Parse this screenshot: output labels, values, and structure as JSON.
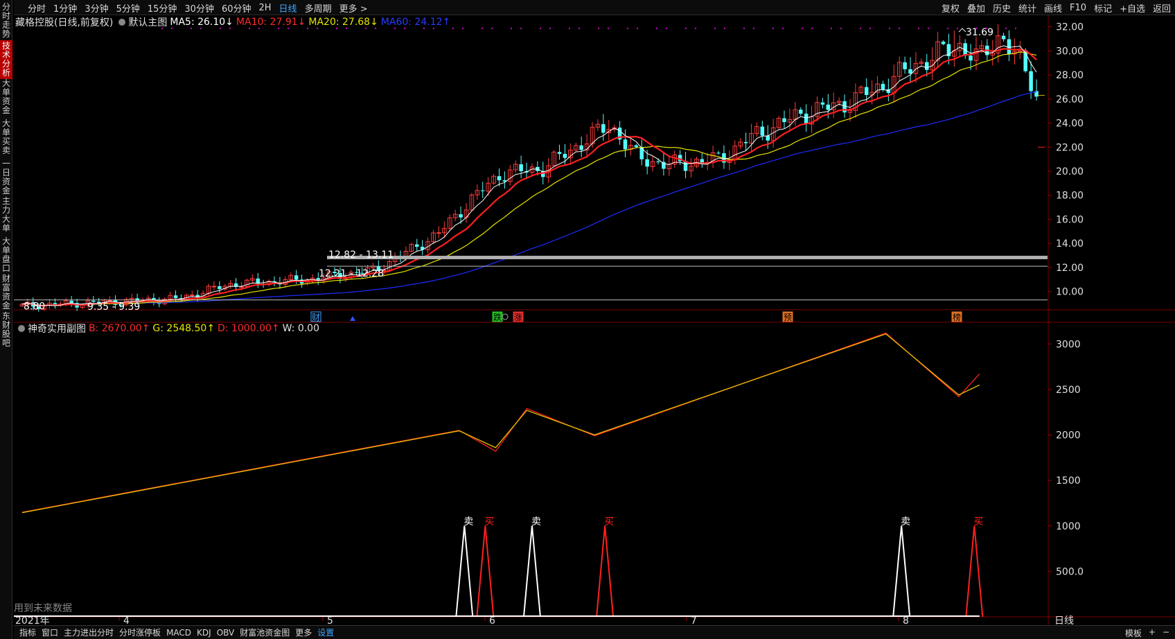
{
  "toolbar": {
    "periods": [
      "分时",
      "1分钟",
      "3分钟",
      "5分钟",
      "15分钟",
      "30分钟",
      "60分钟",
      "2H",
      "日线",
      "多周期",
      "更多 >"
    ],
    "active_period": "日线",
    "right": [
      "复权",
      "叠加",
      "历史",
      "统计",
      "画线",
      "F10",
      "标记",
      "+自选",
      "返回"
    ]
  },
  "sidebar": [
    "分时走势",
    "技术分析",
    "大单资金",
    "大单买卖",
    "一日资金",
    "主力大单",
    "大单盘口",
    "财富资金",
    "东财股吧"
  ],
  "sidebar_active": "技术分析",
  "main_legend": {
    "stock": "藏格控股(日线,前复权)",
    "template": "默认主图",
    "ma5": "MA5: 26.10↓",
    "ma10": "MA10: 27.91↓",
    "ma20": "MA20: 27.68↓",
    "ma60": "MA60: 24.12↑"
  },
  "sub_legend": {
    "name": "神奇实用副图",
    "b": "B: 2670.00↑",
    "g": "G: 2548.50↑",
    "d": "D: 1000.00↑",
    "w": "W: 0.00"
  },
  "annotations": {
    "high": "31.69",
    "low": "8.80",
    "range1": "9.35 - 9.39",
    "range2": "12.21 - 12.28",
    "range3": "12.82 - 13.11",
    "future_data": "用到未来数据"
  },
  "event_markers": [
    "财",
    "跌",
    "涨",
    "预",
    "榜"
  ],
  "signals": {
    "sell": "卖",
    "buy": "买"
  },
  "x_axis": {
    "year": "2021年",
    "months": [
      "4",
      "5",
      "6",
      "7",
      "8"
    ],
    "period_label": "日线"
  },
  "colors": {
    "up": "#ff3b3b",
    "down": "#54ffff",
    "ma5": "#ffffff",
    "ma10": "#ff2020",
    "ma20": "#e6e600",
    "ma60": "#1e2cff"
  },
  "chart_data": [
    {
      "type": "candlestick",
      "ylim": [
        9.0,
        32.5
      ],
      "yticks": [
        "32.00",
        "30.00",
        "28.00",
        "26.00",
        "24.00",
        "22.00",
        "20.00",
        "18.00",
        "16.00",
        "14.00",
        "12.00",
        "10.00"
      ],
      "first_close": 8.8,
      "last_close": 26.2,
      "max_high": 31.69,
      "ma_last": {
        "MA5": 26.1,
        "MA10": 27.91,
        "MA20": 27.68,
        "MA60": 24.12
      }
    },
    {
      "type": "line",
      "ylim": [
        0,
        3200
      ],
      "yticks": [
        "3000",
        "2500",
        "2000",
        "1500",
        "1000",
        "500.0"
      ],
      "series_keypoints": [
        {
          "name": "B",
          "points": [
            [
              0,
              1150
            ],
            [
              84,
              2050
            ],
            [
              91,
              1820
            ],
            [
              97,
              2290
            ],
            [
              110,
              1990
            ],
            [
              166,
              3120
            ],
            [
              180,
              2420
            ],
            [
              184,
              2670
            ]
          ]
        },
        {
          "name": "G",
          "points": [
            [
              0,
              1145
            ],
            [
              84,
              2045
            ],
            [
              91,
              1860
            ],
            [
              97,
              2270
            ],
            [
              110,
              2000
            ],
            [
              166,
              3110
            ],
            [
              180,
              2440
            ],
            [
              184,
              2548.5
            ]
          ]
        }
      ],
      "sell_spikes": [
        85,
        98,
        169
      ],
      "buy_spikes": [
        89,
        112,
        183
      ]
    }
  ]
}
